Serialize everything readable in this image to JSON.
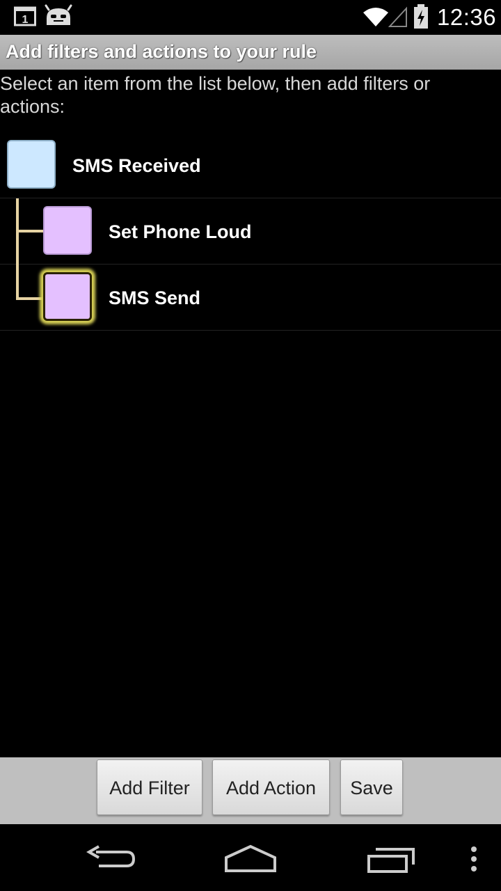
{
  "status_bar": {
    "time": "12:36",
    "calendar_day": "1",
    "icons": [
      "calendar-notification-icon",
      "cyanogenmod-icon",
      "wifi-icon",
      "signal-icon",
      "battery-charging-icon"
    ]
  },
  "title_bar": {
    "title": "Add filters and actions to your rule"
  },
  "instructions": "Select an item from the list below, then add filters or actions:",
  "rule_items": [
    {
      "label": "SMS Received",
      "type": "trigger",
      "color": "#cde8ff"
    },
    {
      "label": "Set Phone Loud",
      "type": "action",
      "color": "#e4c0ff"
    },
    {
      "label": "SMS Send",
      "type": "action",
      "color": "#e4c0ff",
      "selected": true
    }
  ],
  "buttons": {
    "add_filter": "Add Filter",
    "add_action": "Add Action",
    "save": "Save"
  },
  "nav_bar": {
    "icons": [
      "back-icon",
      "home-icon",
      "recent-apps-icon",
      "overflow-menu-icon"
    ]
  }
}
